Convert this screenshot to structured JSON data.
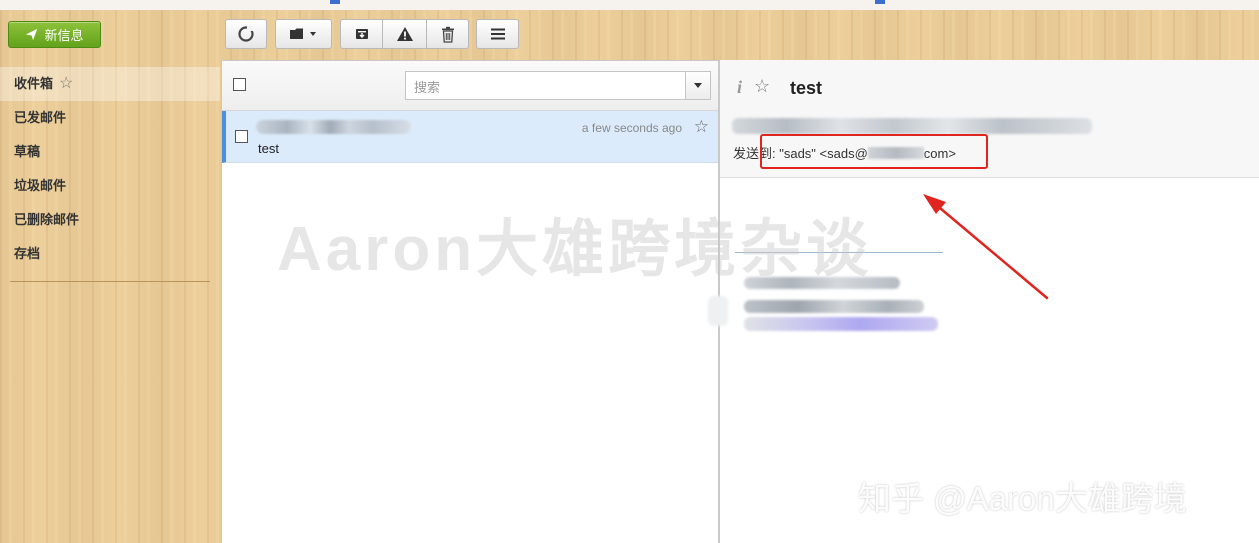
{
  "app": {
    "compose_label": "新信息",
    "accent": "#6aa51f"
  },
  "sidebar": {
    "items": [
      {
        "label": "收件箱",
        "starred_icon": "star-outline-icon"
      },
      {
        "label": "已发邮件"
      },
      {
        "label": "草稿"
      },
      {
        "label": "垃圾邮件"
      },
      {
        "label": "已删除邮件"
      },
      {
        "label": "存档"
      }
    ]
  },
  "toolbar": {
    "buttons": [
      "refresh-icon",
      "folder-move-icon",
      "archive-icon",
      "spam-warning-icon",
      "trash-icon",
      "menu-icon"
    ]
  },
  "list": {
    "search": {
      "placeholder": "搜索"
    },
    "messages": [
      {
        "time": "a few seconds ago",
        "subject": "test",
        "selected": true
      }
    ]
  },
  "reader": {
    "subject": "test",
    "to_prefix": "发送到: \"sads\" <sads@",
    "to_suffix": "com>"
  },
  "watermarks": {
    "center": "Aaron大雄跨境杂谈",
    "bottom": "知乎 @Aaron大雄跨境"
  },
  "annotation": {
    "color": "#e0241f"
  }
}
